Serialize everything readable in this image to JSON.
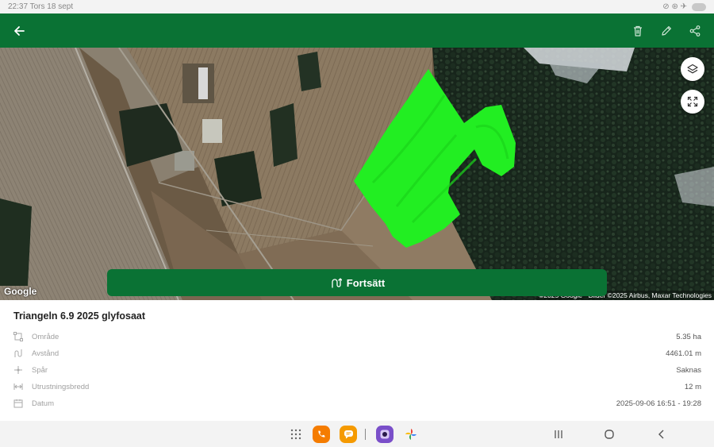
{
  "status_bar": {
    "time": "22:37 Tors 18 sept",
    "right": "⊘ ⊛ ✈"
  },
  "app_bar": {
    "back_icon": "arrow-left-icon",
    "actions": [
      "trash-icon",
      "pencil-icon",
      "share-icon"
    ]
  },
  "map": {
    "google_label": "Google",
    "attribution": "©2025 Google · Bilder ©2025 Airbus, Maxar Technologies",
    "layers_icon": "layers-icon",
    "fullscreen_icon": "fullscreen-icon",
    "coverage_color": "#22ee22"
  },
  "continue_button": {
    "label": "Fortsätt",
    "icon": "route-icon"
  },
  "details": {
    "title": "Triangeln 6.9 2025 glyfosaat",
    "rows": [
      {
        "label": "Område",
        "value": "5.35 ha",
        "icon": "area-icon"
      },
      {
        "label": "Avstånd",
        "value": "4461.01 m",
        "icon": "distance-icon"
      },
      {
        "label": "Spår",
        "value": "Saknas",
        "icon": "track-icon"
      },
      {
        "label": "Utrustningsbredd",
        "value": "12 m",
        "icon": "width-icon"
      },
      {
        "label": "Datum",
        "value": "2025-09-06 16:51 - 19:28",
        "icon": "calendar-icon"
      }
    ]
  },
  "colors": {
    "primary": "#0a7234",
    "phone_app": "#f57c00",
    "messages_app": "#f59a00",
    "camera_app": "#7a4fc9"
  }
}
